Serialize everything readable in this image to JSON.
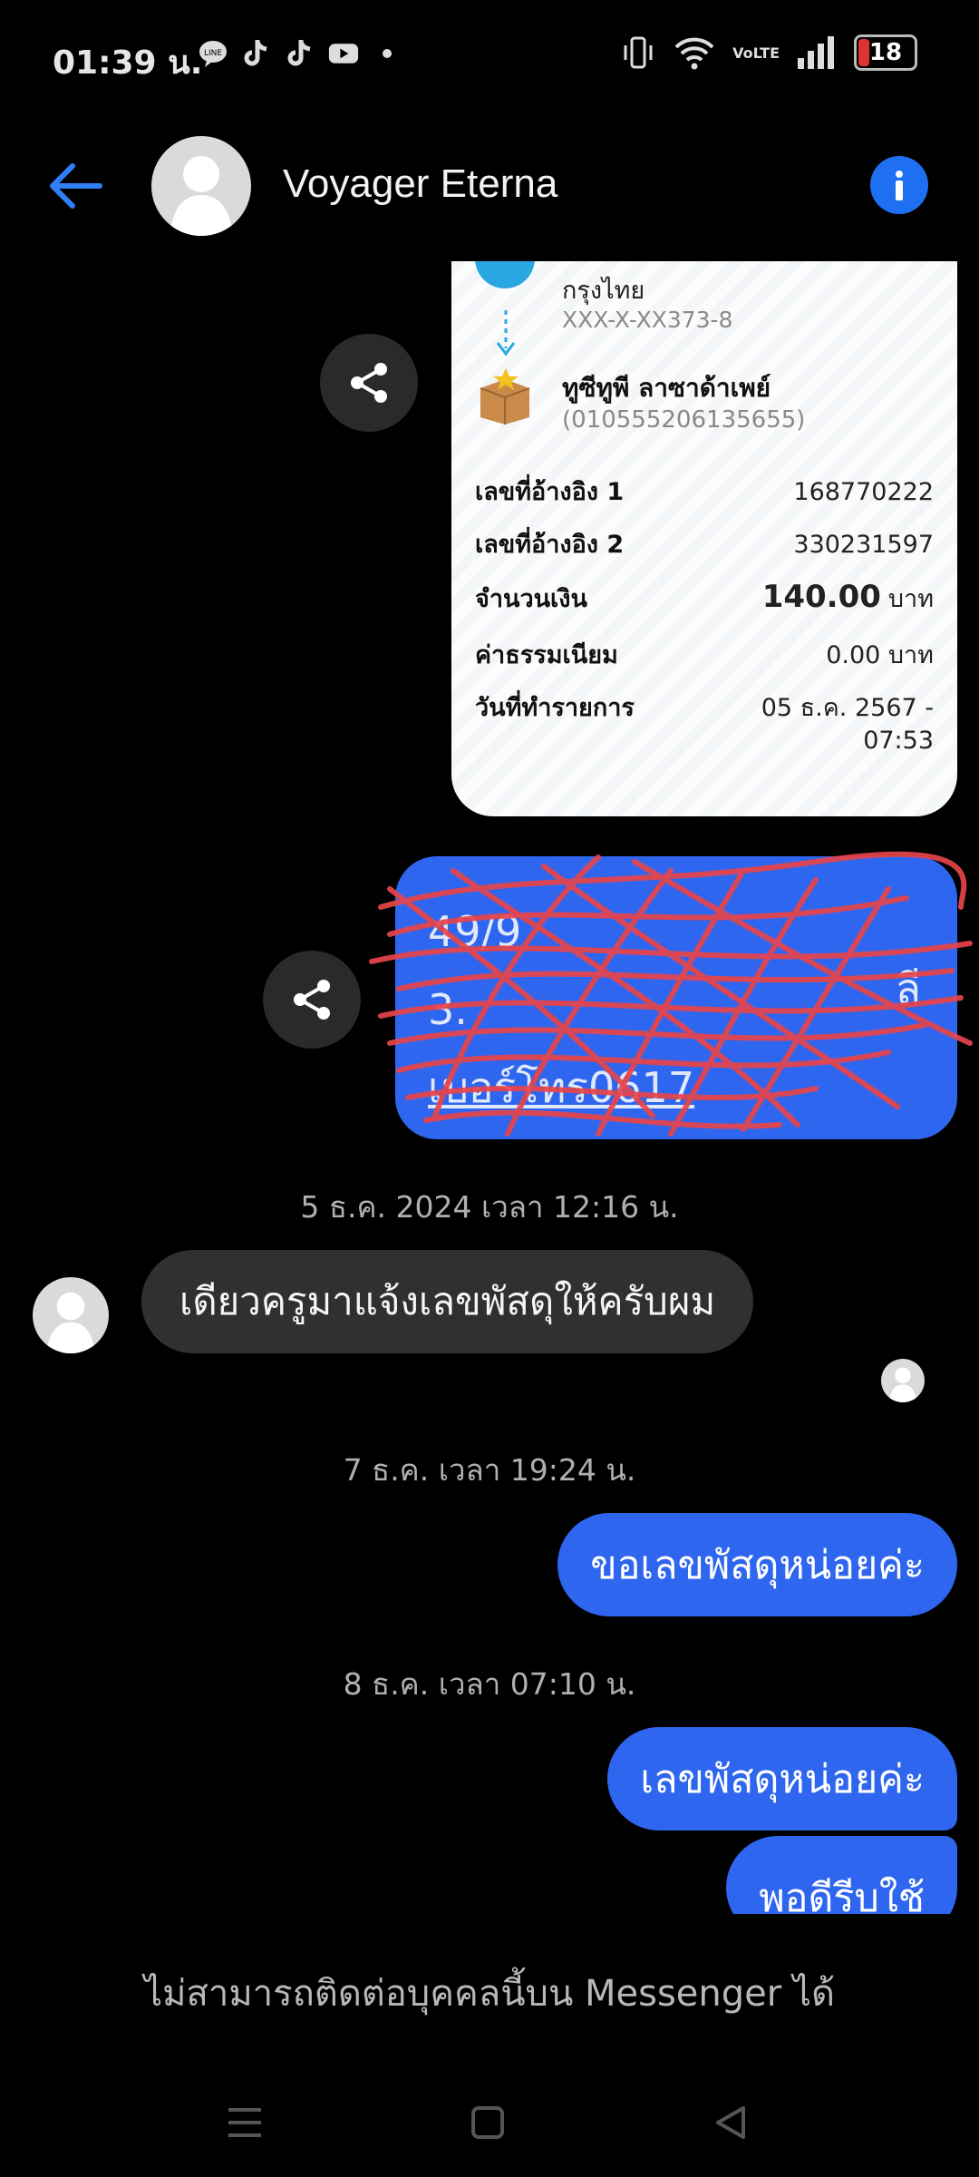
{
  "status_bar": {
    "time": "01:39 น.",
    "battery": "18",
    "battery_level": 0.18,
    "signal": "VoLTE",
    "icons": [
      "line-icon",
      "tiktok-icon",
      "tiktok-icon",
      "youtube-icon",
      "dot-icon",
      "vibrate-icon",
      "wifi-icon",
      "volte-icon",
      "signal-icon",
      "battery-icon"
    ]
  },
  "header": {
    "contact_name": "Voyager Eterna",
    "icons": [
      "back-arrow-icon",
      "avatar-icon",
      "info-icon"
    ]
  },
  "receipt": {
    "bank_name": "กรุงไทย",
    "bank_account": "XXX-X-XX373-8",
    "payee_name": "ทูซีทูพี ลาซาด้าเพย์",
    "payee_id": "(010555206135655)",
    "rows": [
      {
        "label": "เลขที่อ้างอิง 1",
        "value": "168770222"
      },
      {
        "label": "เลขที่อ้างอิง 2",
        "value": "330231597"
      },
      {
        "label": "จำนวนเงิน",
        "value": "140.00",
        "unit": "บาท"
      },
      {
        "label": "ค่าธรรมเนียม",
        "value": "0.00 บาท"
      },
      {
        "label": "วันที่ทำรายการ",
        "value": "05 ธ.ค. 2567 -",
        "value2": "07:53"
      }
    ]
  },
  "redacted_message": {
    "line1": "49/9",
    "line2": "3.",
    "line3": "เบอร์โทร0617",
    "trailing": "ลี"
  },
  "messages": {
    "timestamp_1": "5 ธ.ค. 2024 เวลา 12:16 น.",
    "incoming_1": "เดียวครูมาแจ้งเลขพัสดุให้ครับผม",
    "timestamp_2": "7 ธ.ค. เวลา 19:24 น.",
    "outgoing_1": "ขอเลขพัสดุหน่อยค่ะ",
    "timestamp_3": "8 ธ.ค. เวลา 07:10 น.",
    "outgoing_2": "เลขพัสดุหน่อยค่ะ",
    "outgoing_3": "พอดีรีบใช้"
  },
  "footer": {
    "note": "ไม่สามารถติดต่อบุคคลนี้บน Messenger ได้"
  },
  "colors": {
    "background": "#000000",
    "accent": "#2f66ef",
    "info": "#1f6ff2",
    "incoming_bubble": "#303030",
    "battery_low": "#e03434"
  }
}
